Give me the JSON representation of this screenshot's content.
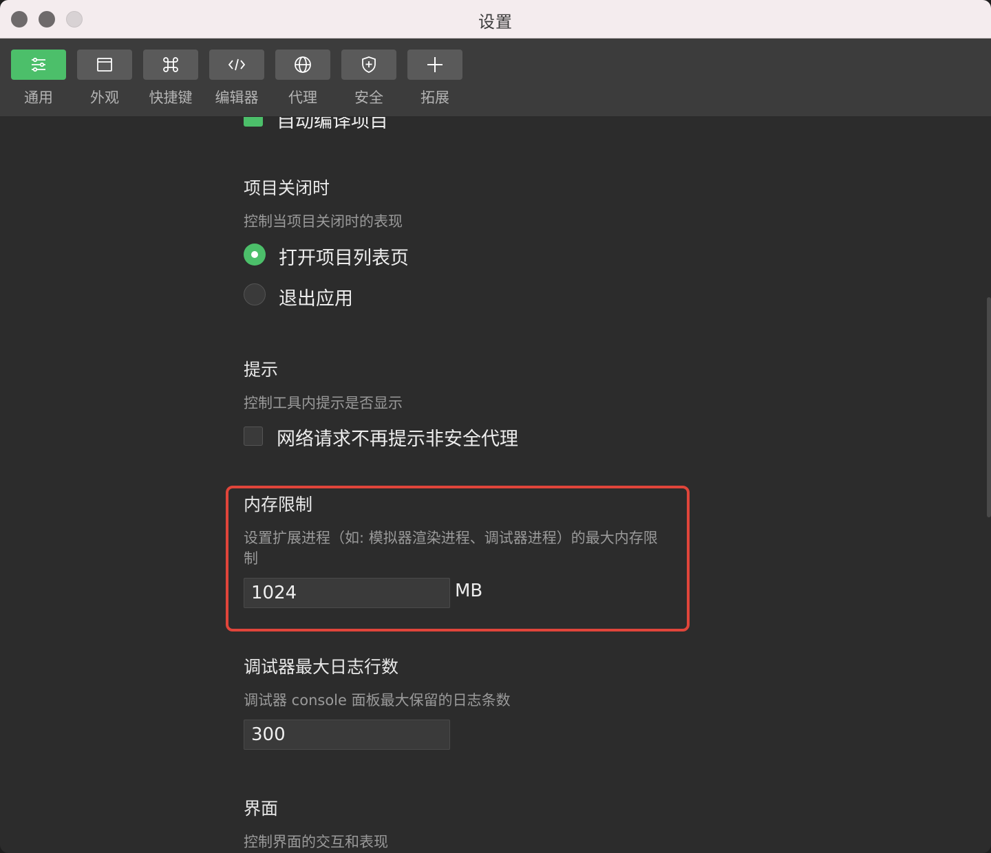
{
  "window": {
    "title": "设置"
  },
  "toolbar": {
    "tabs": [
      {
        "label": "通用",
        "icon": "settings-list-icon",
        "active": true
      },
      {
        "label": "外观",
        "icon": "window-icon",
        "active": false
      },
      {
        "label": "快捷键",
        "icon": "command-key-icon",
        "active": false
      },
      {
        "label": "编辑器",
        "icon": "code-icon",
        "active": false
      },
      {
        "label": "代理",
        "icon": "globe-icon",
        "active": false
      },
      {
        "label": "安全",
        "icon": "shield-icon",
        "active": false
      },
      {
        "label": "拓展",
        "icon": "plus-icon",
        "active": false
      }
    ]
  },
  "sections": {
    "auto_compile": {
      "label": "自动编译项目",
      "checked": true
    },
    "on_close": {
      "title": "项目关闭时",
      "desc": "控制当项目关闭时的表现",
      "options": [
        {
          "label": "打开项目列表页",
          "selected": true
        },
        {
          "label": "退出应用",
          "selected": false
        }
      ]
    },
    "tips": {
      "title": "提示",
      "desc": "控制工具内提示是否显示",
      "checkbox_label": "网络请求不再提示非安全代理",
      "checked": false
    },
    "memory": {
      "title": "内存限制",
      "desc_line1": "设置扩展进程（如: 模拟器渲染进程、调试器进程）的最大内存限",
      "desc_line2": "制",
      "value": "1024",
      "unit": "MB"
    },
    "debug_log": {
      "title": "调试器最大日志行数",
      "desc": "调试器 console 面板最大保留的日志条数",
      "value": "300"
    },
    "ui": {
      "title": "界面",
      "desc": "控制界面的交互和表现"
    }
  },
  "colors": {
    "accent": "#4cbf6a",
    "highlight": "#e0453a"
  }
}
